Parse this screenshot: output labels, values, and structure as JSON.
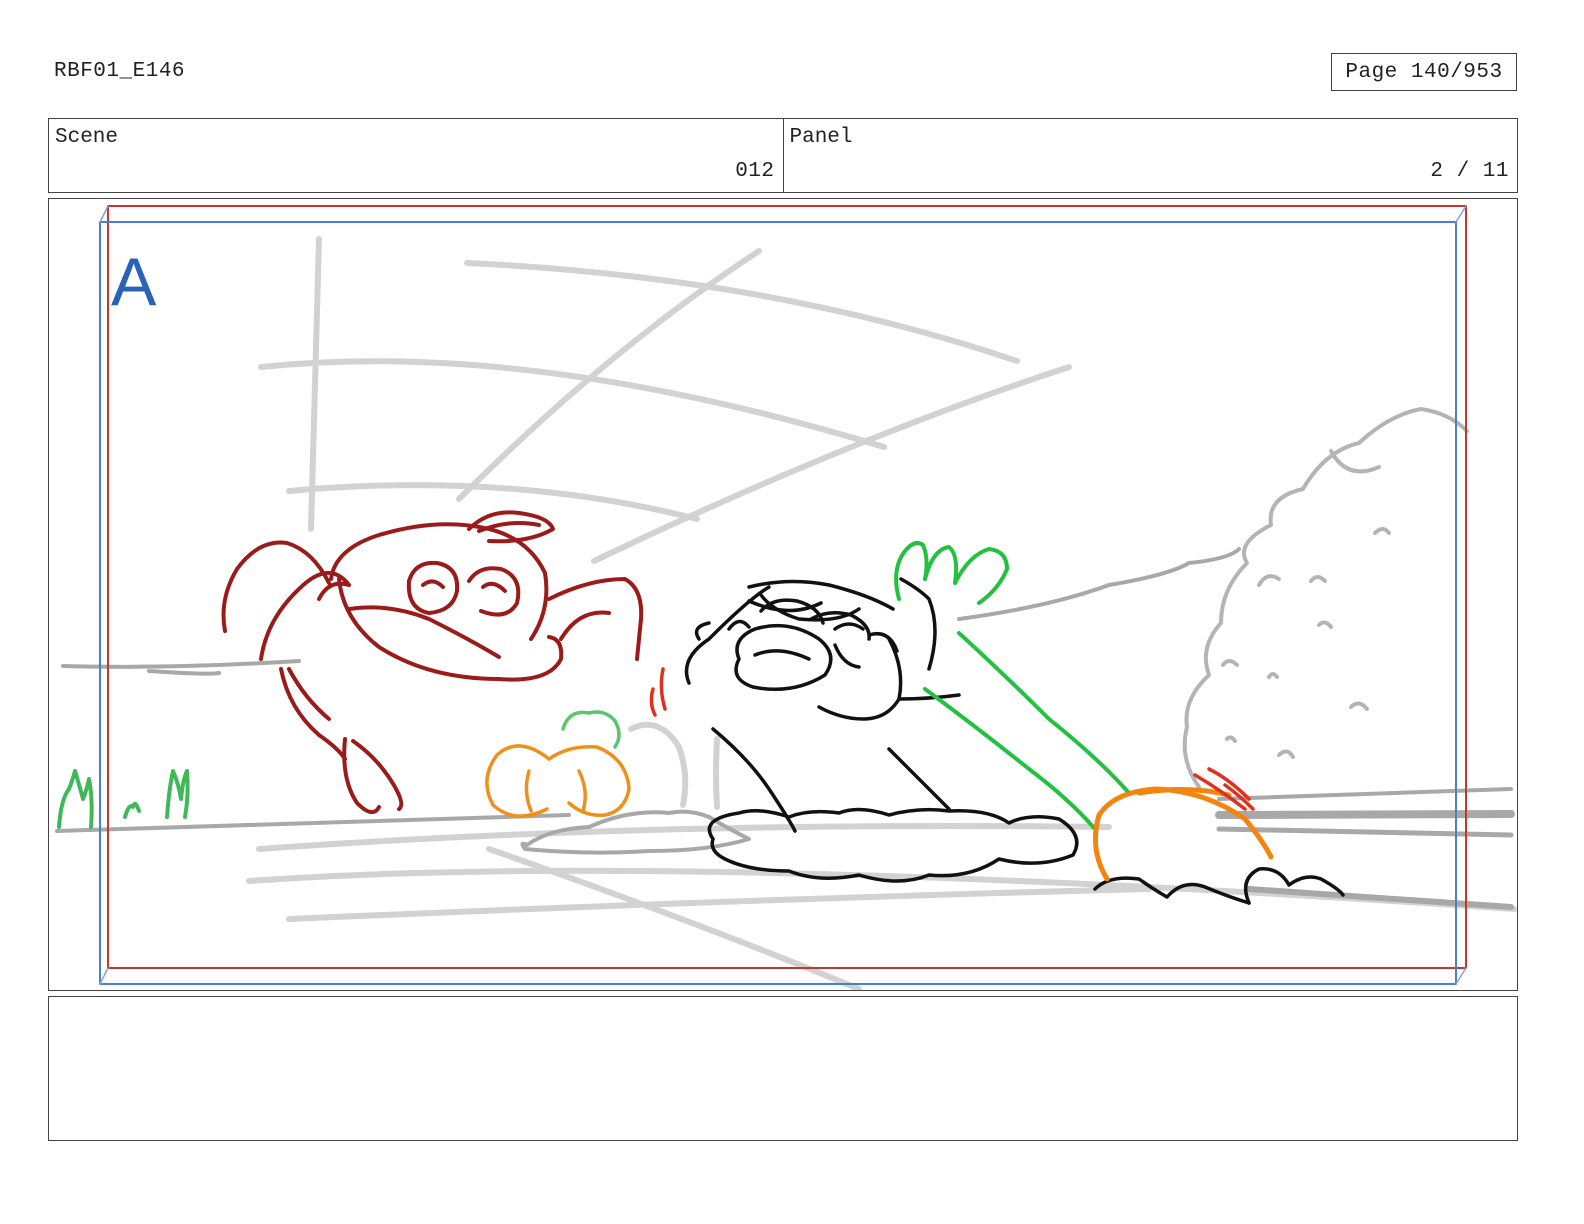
{
  "header": {
    "doc_id": "RBF01_E146",
    "page_label": "Page 140/953"
  },
  "info": {
    "scene_label": "Scene",
    "scene_value": "012",
    "panel_label": "Panel",
    "panel_value": "2 / 11"
  },
  "panel": {
    "letter": "A",
    "colors": {
      "letter": "#2a62b8",
      "safe_frame": "#c0392b",
      "camera_frame": "#4a7fd0",
      "rough": "#d2d2d2",
      "ground": "#a8a8a8",
      "bunny": "#9b1b1b",
      "character": "#111111",
      "carrot_top": "#22c140",
      "carrot": "#f5840f",
      "pumpkin": "#f0901c",
      "accent_red": "#e0301e"
    }
  },
  "notes": {
    "text": ""
  }
}
